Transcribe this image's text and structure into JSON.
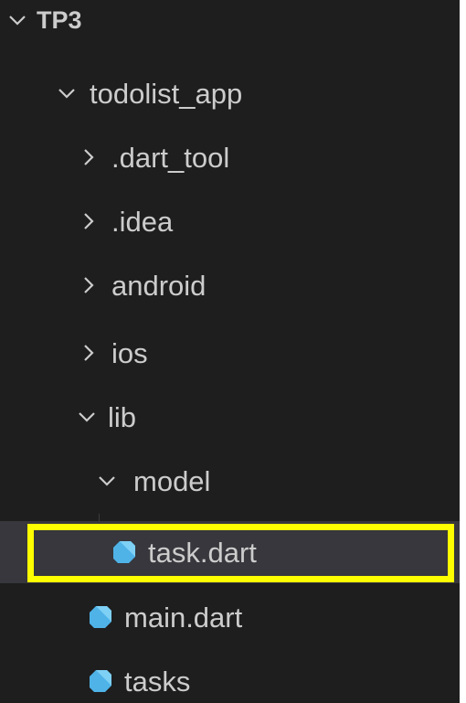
{
  "explorer": {
    "root": {
      "label": "TP3",
      "expanded": true
    },
    "items": [
      {
        "label": "todolist_app",
        "type": "folder",
        "expanded": true
      },
      {
        "label": ".dart_tool",
        "type": "folder",
        "expanded": false
      },
      {
        "label": ".idea",
        "type": "folder",
        "expanded": false
      },
      {
        "label": "android",
        "type": "folder",
        "expanded": false
      },
      {
        "label": "ios",
        "type": "folder",
        "expanded": false
      },
      {
        "label": "lib",
        "type": "folder",
        "expanded": true
      },
      {
        "label": "model",
        "type": "folder",
        "expanded": true
      },
      {
        "label": "task.dart",
        "type": "dart-file",
        "selected": true
      },
      {
        "label": "main.dart",
        "type": "dart-file"
      },
      {
        "label": "tasks",
        "type": "dart-file"
      }
    ]
  },
  "colors": {
    "background": "#1e1e1e",
    "text": "#cccccc",
    "selected_row": "#37373d",
    "highlight_outline": "#ffff00",
    "dart_icon": "#4fb3e8"
  }
}
